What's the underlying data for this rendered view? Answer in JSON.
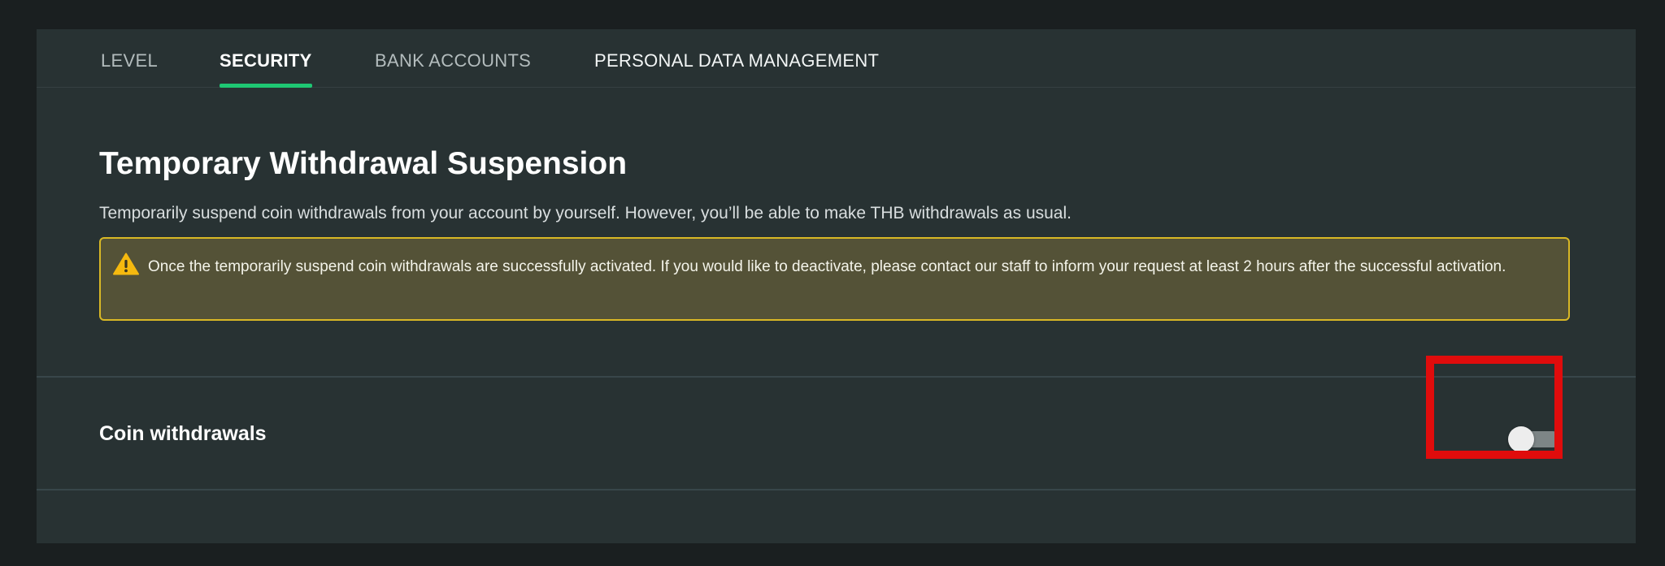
{
  "tabs": [
    {
      "label": "LEVEL",
      "active": false
    },
    {
      "label": "SECURITY",
      "active": true
    },
    {
      "label": "BANK ACCOUNTS",
      "active": false
    },
    {
      "label": "PERSONAL DATA MANAGEMENT",
      "active": false
    }
  ],
  "section": {
    "title": "Temporary Withdrawal Suspension",
    "description": "Temporarily suspend coin withdrawals from your account by yourself. However, you’ll be able to make THB withdrawals as usual.",
    "warning": {
      "icon": "warning-triangle-icon",
      "text": "Once the temporarily suspend coin withdrawals are successfully activated. If you would like to deactivate, please contact our staff to inform your request at least 2 hours after the successful activation."
    }
  },
  "setting": {
    "label": "Coin withdrawals",
    "toggle_on": false
  },
  "colors": {
    "accent": "#1ec773",
    "warning_border": "#d9b825",
    "highlight_box": "#e00c0c"
  }
}
